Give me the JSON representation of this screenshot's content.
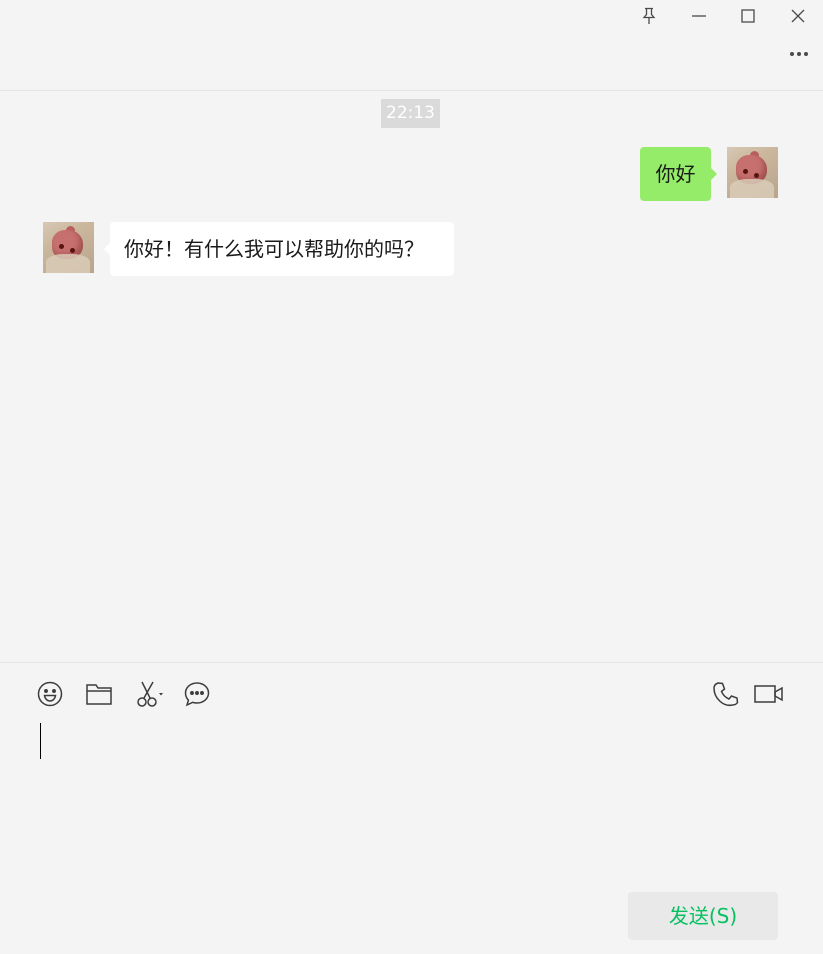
{
  "title_bar": {
    "controls": [
      "pin-icon",
      "minimize-icon",
      "maximize-icon",
      "close-icon"
    ],
    "more_icon": "more-icon"
  },
  "chat": {
    "timestamp": "22:13",
    "messages": [
      {
        "sender": "me",
        "text": "你好",
        "bubble_color": "#95ec69"
      },
      {
        "sender": "other",
        "text": "你好！有什么我可以帮助你的吗？",
        "bubble_color": "#ffffff"
      }
    ]
  },
  "toolbar": {
    "left_tools": [
      "emoji-icon",
      "folder-icon",
      "screenshot-icon",
      "chat-history-icon"
    ],
    "right_tools": [
      "voice-call-icon",
      "video-call-icon"
    ]
  },
  "input": {
    "value": ""
  },
  "send_button": {
    "label": "发送(S)",
    "text_color": "#07c160"
  }
}
